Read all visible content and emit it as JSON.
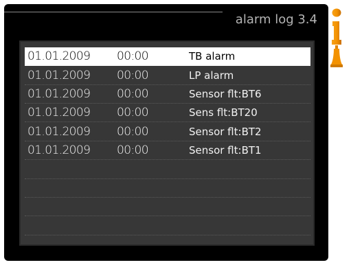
{
  "header": {
    "title": "alarm log 3.4"
  },
  "log": {
    "rows": [
      {
        "date": "01.01.2009",
        "time": "00:00",
        "text": "TB alarm",
        "selected": true
      },
      {
        "date": "01.01.2009",
        "time": "00:00",
        "text": "LP alarm",
        "selected": false
      },
      {
        "date": "01.01.2009",
        "time": "00:00",
        "text": "Sensor flt:BT6",
        "selected": false
      },
      {
        "date": "01.01.2009",
        "time": "00:00",
        "text": "Sens flt:BT20",
        "selected": false
      },
      {
        "date": "01.01.2009",
        "time": "00:00",
        "text": "Sensor flt:BT2",
        "selected": false
      },
      {
        "date": "01.01.2009",
        "time": "00:00",
        "text": "Sensor flt:BT1",
        "selected": false
      }
    ]
  },
  "side_icons": [
    {
      "name": "info-icon",
      "color": "#f39200"
    },
    {
      "name": "alarm-bell-icon",
      "color": "#f39200"
    }
  ],
  "colors": {
    "screen_background": "#000000",
    "panel_background": "#373737",
    "selected_row": "#ffffff",
    "accent": "#f39200"
  }
}
